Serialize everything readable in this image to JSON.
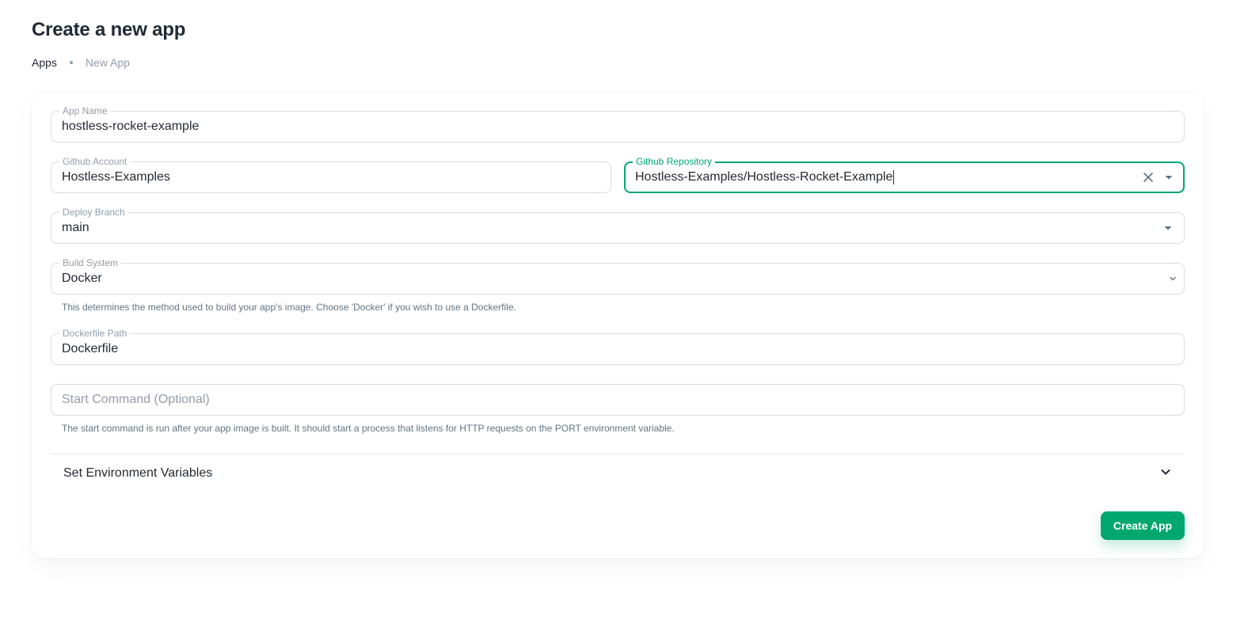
{
  "page": {
    "title": "Create a new app",
    "breadcrumb": {
      "parent": "Apps",
      "current": "New App"
    }
  },
  "form": {
    "app_name": {
      "label": "App Name",
      "value": "hostless-rocket-example"
    },
    "github_account": {
      "label": "Github Account",
      "value": "Hostless-Examples"
    },
    "github_repository": {
      "label": "Github Repository",
      "value": "Hostless-Examples/Hostless-Rocket-Example",
      "focused": true
    },
    "deploy_branch": {
      "label": "Deploy Branch",
      "value": "main"
    },
    "build_system": {
      "label": "Build System",
      "value": "Docker",
      "helper": "This determines the method used to build your app's image. Choose 'Docker' if you wish to use a Dockerfile."
    },
    "dockerfile_path": {
      "label": "Dockerfile Path",
      "value": "Dockerfile"
    },
    "start_command": {
      "placeholder": "Start Command (Optional)",
      "value": "",
      "helper": "The start command is run after your app image is built. It should start a process that listens for HTTP requests on the PORT environment variable."
    },
    "env_vars": {
      "title": "Set Environment Variables",
      "expanded": false
    },
    "submit_label": "Create App"
  },
  "icons": {
    "clear": "close-icon",
    "dropdown": "caret-down-icon",
    "select": "chevron-down-icon",
    "accordion": "chevron-down-icon"
  },
  "colors": {
    "primary": "#00a76f",
    "text": "#212b36",
    "muted": "#919eab",
    "border": "#d8dde2"
  }
}
